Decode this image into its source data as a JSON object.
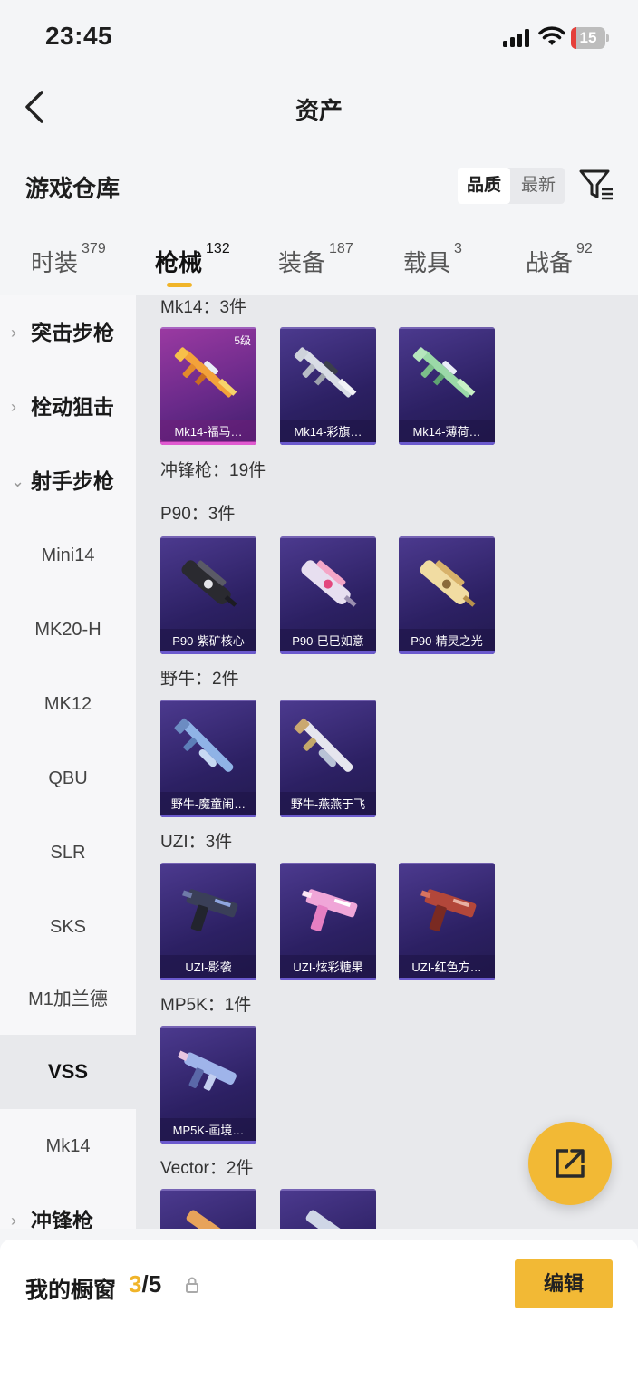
{
  "status_bar": {
    "time": "23:45",
    "battery": "15",
    "battery_level": 0.15
  },
  "nav": {
    "title": "资产"
  },
  "warehouse": {
    "title": "游戏仓库",
    "sort_quality": "品质",
    "sort_latest": "最新"
  },
  "tabs": [
    {
      "label": "时装",
      "count": "379"
    },
    {
      "label": "枪械",
      "count": "132"
    },
    {
      "label": "装备",
      "count": "187"
    },
    {
      "label": "载具",
      "count": "3"
    },
    {
      "label": "战备",
      "count": "92"
    }
  ],
  "sidebar": [
    {
      "label": "突击步枪",
      "chevron": "›"
    },
    {
      "label": "栓动狙击",
      "chevron": "›"
    },
    {
      "label": "射手步枪",
      "chevron": "⌄"
    },
    {
      "label": "Mini14"
    },
    {
      "label": "MK20-H"
    },
    {
      "label": "MK12"
    },
    {
      "label": "QBU"
    },
    {
      "label": "SLR"
    },
    {
      "label": "SKS"
    },
    {
      "label": "M1加兰德"
    },
    {
      "label": "VSS"
    },
    {
      "label": "Mk14"
    },
    {
      "label": "冲锋枪",
      "chevron": "›"
    }
  ],
  "sections": [
    {
      "title": "Mk14：3件"
    },
    {
      "title": "冲锋枪：19件"
    },
    {
      "title": "P90：3件"
    },
    {
      "title": "野牛：2件"
    },
    {
      "title": "UZI：3件"
    },
    {
      "title": "MP5K：1件"
    },
    {
      "title": "Vector：2件"
    }
  ],
  "cards": [
    {
      "label": "Mk14-福马…",
      "level": "5级"
    },
    {
      "label": "Mk14-彩旗…"
    },
    {
      "label": "Mk14-薄荷…"
    },
    {
      "label": "P90-紫矿核心"
    },
    {
      "label": "P90-巳巳如意"
    },
    {
      "label": "P90-精灵之光"
    },
    {
      "label": "野牛-魔童闹…"
    },
    {
      "label": "野牛-燕燕于飞"
    },
    {
      "label": "UZI-影袭"
    },
    {
      "label": "UZI-炫彩糖果"
    },
    {
      "label": "UZI-红色方…"
    },
    {
      "label": "MP5K-画境…"
    },
    {
      "label": ""
    },
    {
      "label": ""
    }
  ],
  "showcase": {
    "title": "我的橱窗",
    "current": "3",
    "total": "/5",
    "edit_label": "编辑"
  },
  "colors": {
    "accent": "#f2b935",
    "card_purple": "#2c2063",
    "card_pink": "#9b3aa2"
  }
}
